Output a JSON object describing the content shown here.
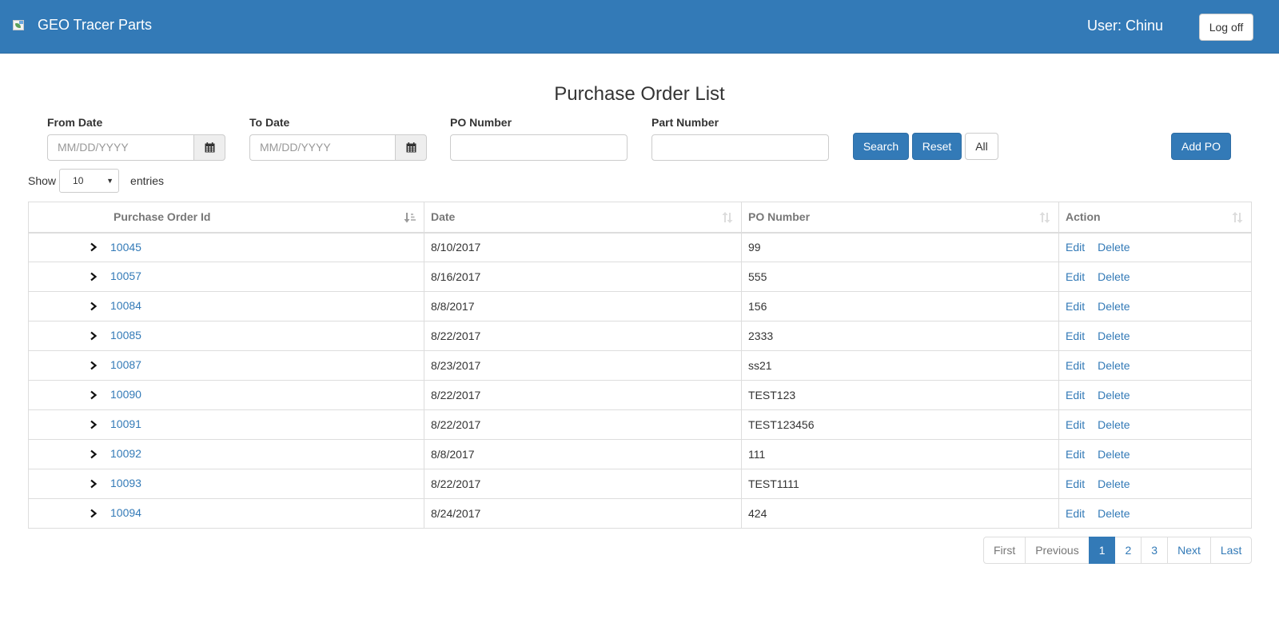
{
  "header": {
    "brand": "GEO Tracer Parts",
    "user_label": "User: Chinu",
    "logoff_label": "Log off"
  },
  "page": {
    "title": "Purchase Order List"
  },
  "filters": {
    "from_date": {
      "label": "From Date",
      "placeholder": "MM/DD/YYYY",
      "icon": "calendar-icon"
    },
    "to_date": {
      "label": "To Date",
      "placeholder": "MM/DD/YYYY",
      "icon": "calendar-icon"
    },
    "po_number": {
      "label": "PO Number",
      "value": ""
    },
    "part_number": {
      "label": "Part Number",
      "value": ""
    },
    "buttons": {
      "search": "Search",
      "reset": "Reset",
      "all": "All",
      "add_po": "Add PO"
    }
  },
  "length": {
    "show": "Show",
    "selected": "10",
    "entries": "entries"
  },
  "table": {
    "columns": [
      "Purchase Order Id",
      "Date",
      "PO Number",
      "Action"
    ],
    "rows": [
      {
        "id": "10045",
        "date": "8/10/2017",
        "po": "99"
      },
      {
        "id": "10057",
        "date": "8/16/2017",
        "po": "555"
      },
      {
        "id": "10084",
        "date": "8/8/2017",
        "po": "156"
      },
      {
        "id": "10085",
        "date": "8/22/2017",
        "po": "2333"
      },
      {
        "id": "10087",
        "date": "8/23/2017",
        "po": "ss21"
      },
      {
        "id": "10090",
        "date": "8/22/2017",
        "po": "TEST123"
      },
      {
        "id": "10091",
        "date": "8/22/2017",
        "po": "TEST123456"
      },
      {
        "id": "10092",
        "date": "8/8/2017",
        "po": "111"
      },
      {
        "id": "10093",
        "date": "8/22/2017",
        "po": "TEST1111"
      },
      {
        "id": "10094",
        "date": "8/24/2017",
        "po": "424"
      }
    ],
    "edit_label": "Edit",
    "delete_label": "Delete"
  },
  "pagination": {
    "first": "First",
    "previous": "Previous",
    "pages": [
      "1",
      "2",
      "3"
    ],
    "active": "1",
    "next": "Next",
    "last": "Last"
  },
  "colors": {
    "primary": "#337ab7",
    "header_bg": "#337ab7",
    "border": "#dddddd"
  }
}
